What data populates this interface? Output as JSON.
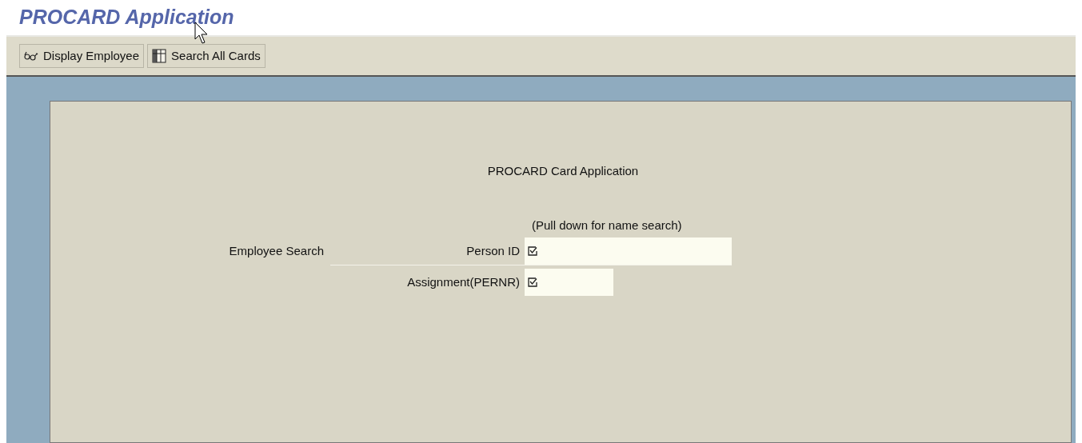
{
  "page_title": "PROCARD Application",
  "toolbar": [
    {
      "kind": "glasses",
      "label": "Display Employee"
    },
    {
      "kind": "table",
      "label": "Search All Cards"
    }
  ],
  "form": {
    "heading": "PROCARD Card Application",
    "hint": "(Pull down for name search)",
    "section_label": "Employee Search",
    "fields": [
      {
        "label": "Person ID",
        "kind": "long"
      },
      {
        "label": "Assignment(PERNR)",
        "kind": "short"
      }
    ]
  }
}
